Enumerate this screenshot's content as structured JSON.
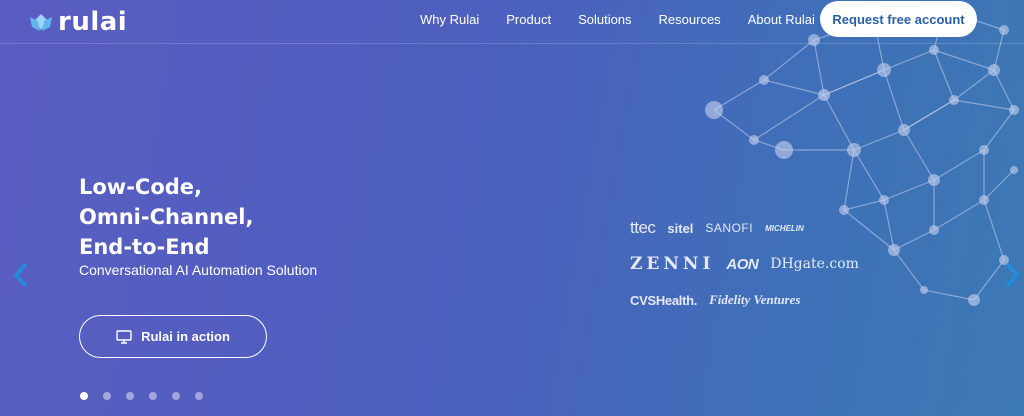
{
  "header": {
    "logo_text": "rulai",
    "nav": [
      "Why Rulai",
      "Product",
      "Solutions",
      "Resources",
      "About Rulai"
    ],
    "cta_label": "Request free account"
  },
  "hero": {
    "title_lines": [
      "Low-Code,",
      "Omni-Channel,",
      "End-to-End"
    ],
    "subtitle": "Conversational AI Automation Solution",
    "action_label": "Rulai in action"
  },
  "clients": {
    "row1": [
      "ttec",
      "sitel",
      "SANOFI",
      "MICHELIN"
    ],
    "row2": [
      "ZENNI",
      "AON",
      "DHgate.com"
    ],
    "row3": [
      "CVSHealth.",
      "Fidelity Ventures"
    ]
  },
  "carousel": {
    "slide_count": 6,
    "active_index": 0
  },
  "colors": {
    "background": "#5a5dc1",
    "accent": "#2a5ea8",
    "arrow": "#1e8fe0"
  }
}
